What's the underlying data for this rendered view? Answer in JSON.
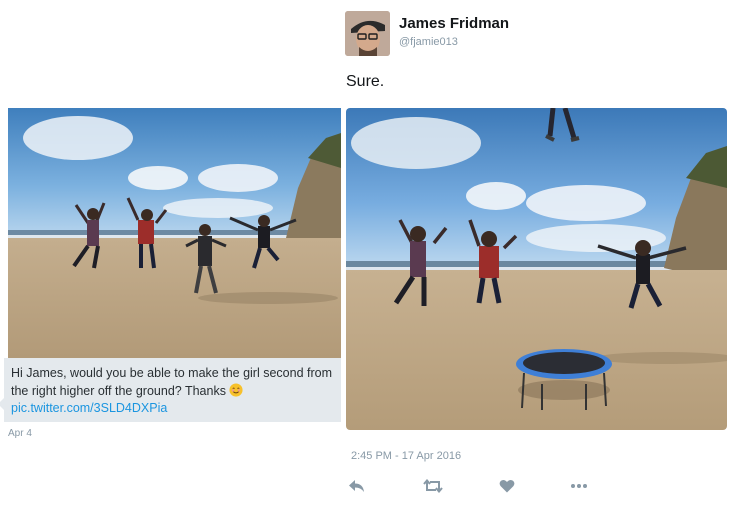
{
  "quoted_tweet": {
    "text": "Hi James, would you be able to make the girl second from the right higher off the ground? Thanks",
    "link": "pic.twitter.com/3SLD4DXPia",
    "date": "Apr 4",
    "emoji": "smiling-face-emoji"
  },
  "reply_tweet": {
    "display_name": "James Fridman",
    "handle": "@fjamie013",
    "text": "Sure.",
    "timestamp": "2:45 PM - 17 Apr 2016"
  },
  "actions": [
    {
      "name": "reply",
      "icon": "reply-icon"
    },
    {
      "name": "retweet",
      "icon": "retweet-icon"
    },
    {
      "name": "like",
      "icon": "heart-icon"
    },
    {
      "name": "more",
      "icon": "more-icon"
    }
  ],
  "colors": {
    "link": "#1b95e0",
    "meta": "#8899a6",
    "quote_background": "#e4e9ed",
    "trampoline": "#3f7fd6"
  }
}
